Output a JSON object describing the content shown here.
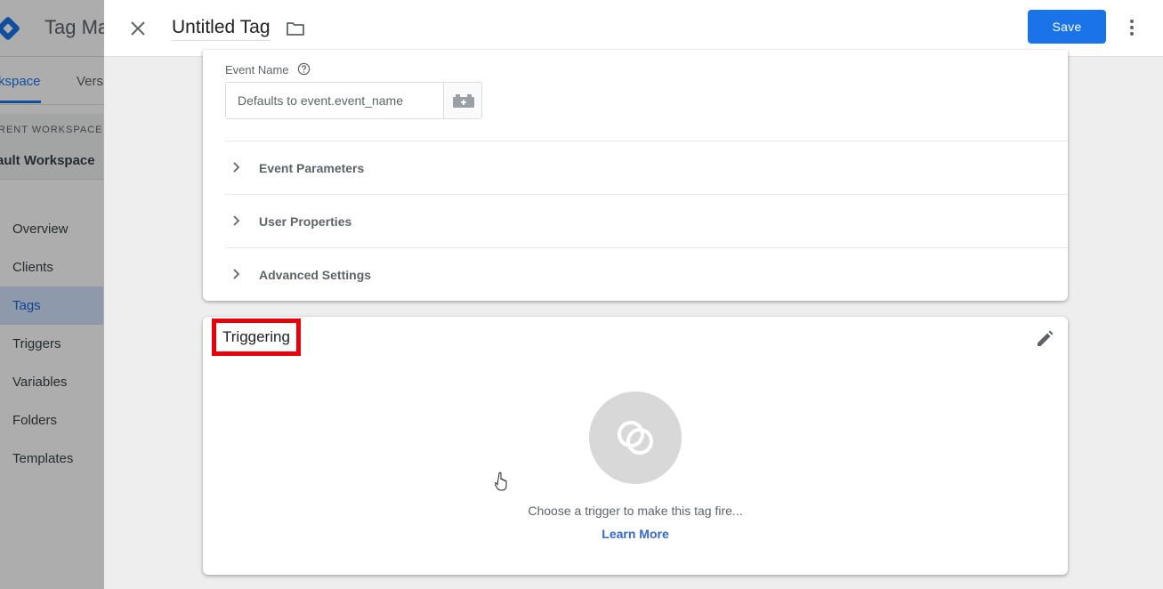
{
  "background_app": {
    "title": "Tag Ma",
    "tabs": [
      {
        "label": "kspace"
      },
      {
        "label": "Vers"
      }
    ],
    "workspace_label": "RENT WORKSPACE",
    "workspace_name": "ault Workspace",
    "nav": [
      {
        "label": "Overview"
      },
      {
        "label": "Clients"
      },
      {
        "label": "Tags"
      },
      {
        "label": "Triggers"
      },
      {
        "label": "Variables"
      },
      {
        "label": "Folders"
      },
      {
        "label": "Templates"
      }
    ],
    "active_nav": "Tags"
  },
  "header": {
    "close_icon": "close-icon",
    "title": "Untitled Tag",
    "folder_icon": "folder-icon",
    "save_label": "Save",
    "more_icon": "more-vert-icon"
  },
  "config": {
    "event_name_label": "Event Name",
    "event_name_value": "",
    "event_name_placeholder": "Defaults to event.event_name",
    "help_icon": "help-circle-icon",
    "variable_icon": "variable-picker-icon",
    "sections": [
      {
        "label": "Event Parameters",
        "icon": "chevron-right-icon"
      },
      {
        "label": "User Properties",
        "icon": "chevron-right-icon"
      },
      {
        "label": "Advanced Settings",
        "icon": "chevron-right-icon"
      }
    ]
  },
  "triggering": {
    "title": "Triggering",
    "edit_icon": "pencil-icon",
    "trigger_icon": "trigger-circles-icon",
    "empty_text": "Choose a trigger to make this tag fire...",
    "learn_more": "Learn More"
  },
  "colors": {
    "accent": "#1a73e8",
    "highlight_box": "#e8000b",
    "link": "#3367d6"
  }
}
